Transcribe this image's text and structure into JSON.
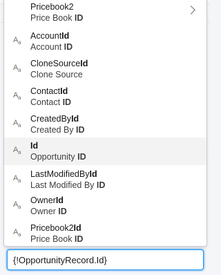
{
  "items": [
    {
      "name_prefix": "Pricebook2",
      "name_bold": "",
      "sub_prefix": "Price Book ",
      "sub_bold": "ID",
      "has_chevron": true,
      "icon": "none"
    },
    {
      "name_prefix": "Account",
      "name_bold": "Id",
      "sub_prefix": "Account ",
      "sub_bold": "ID",
      "icon": "text-type-icon"
    },
    {
      "name_prefix": "CloneSource",
      "name_bold": "Id",
      "sub_prefix": "Clone Source",
      "sub_bold": "",
      "icon": "text-type-icon"
    },
    {
      "name_prefix": "Contact",
      "name_bold": "Id",
      "sub_prefix": "Contact ",
      "sub_bold": "ID",
      "icon": "text-type-icon"
    },
    {
      "name_prefix": "CreatedBy",
      "name_bold": "Id",
      "sub_prefix": "Created By ",
      "sub_bold": "ID",
      "icon": "text-type-icon"
    },
    {
      "name_prefix": "",
      "name_bold": "Id",
      "sub_prefix": "Opportunity ",
      "sub_bold": "ID",
      "icon": "text-type-icon",
      "selected": true
    },
    {
      "name_prefix": "LastModifiedBy",
      "name_bold": "Id",
      "sub_prefix": "Last Modified By ",
      "sub_bold": "ID",
      "icon": "text-type-icon"
    },
    {
      "name_prefix": "Owner",
      "name_bold": "Id",
      "sub_prefix": "Owner ",
      "sub_bold": "ID",
      "icon": "text-type-icon"
    },
    {
      "name_prefix": "Pricebook2",
      "name_bold": "Id",
      "sub_prefix": "Price Book ",
      "sub_bold": "ID",
      "icon": "text-type-icon"
    }
  ],
  "icon_glyph": {
    "big": "A",
    "small": "a"
  },
  "input": {
    "value": "{!OpportunityRecord.Id}"
  },
  "colors": {
    "selected_row": "#f3f3f3",
    "input_focus": "#1b96ff"
  }
}
